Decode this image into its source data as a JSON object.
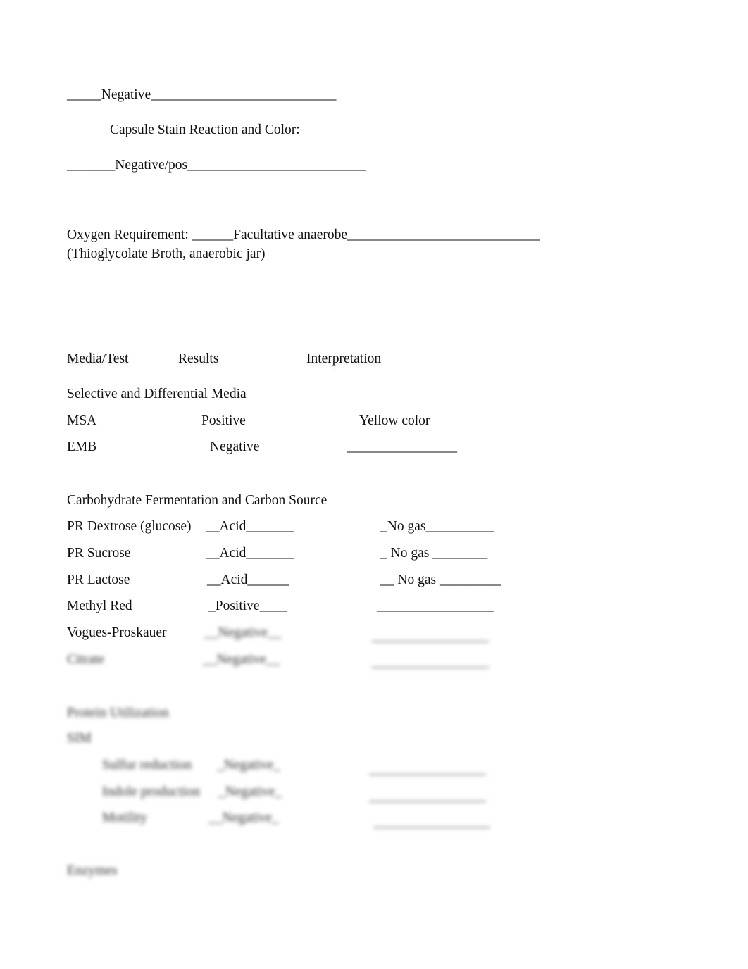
{
  "gram": {
    "line": "_____Negative___________________________"
  },
  "capsule": {
    "label": "Capsule Stain Reaction and Color:",
    "line": "_______Negative/pos__________________________"
  },
  "oxygen": {
    "label": "Oxygen Requirement: ______Facultative anaerobe____________________________",
    "note": "(Thioglycolate Broth, anaerobic jar)"
  },
  "table_headers": [
    "Media/Test",
    "Results",
    "Interpretation"
  ],
  "selective": {
    "heading": "Selective and Differential Media",
    "rows": [
      {
        "test": "MSA",
        "result": "Positive",
        "interp": "Yellow color"
      },
      {
        "test": "EMB",
        "result": "Negative",
        "interp": "________________"
      }
    ]
  },
  "carbo": {
    "heading": "Carbohydrate Fermentation and Carbon Source",
    "rows": [
      {
        "test": "PR Dextrose (glucose)",
        "result": "__Acid_______",
        "interp": "_No gas__________"
      },
      {
        "test": "PR Sucrose",
        "result": "__Acid_______",
        "interp": "_ No gas ________"
      },
      {
        "test": "PR Lactose",
        "result": "__Acid______",
        "interp": "__ No gas _________"
      },
      {
        "test": "Methyl Red",
        "result": "_Positive____",
        "interp": "_________________"
      },
      {
        "test": "Vogues-Proskauer",
        "result": "__Negative__",
        "interp": "_________________"
      },
      {
        "test": "Citrate",
        "result": "__Negative__",
        "interp": "_________________"
      }
    ]
  },
  "protein": {
    "heading": "Protein Utilization",
    "sub": "SIM",
    "rows": [
      {
        "test": "Sulfur reduction",
        "result": "_Negative_",
        "interp": "_________________"
      },
      {
        "test": "Indole production",
        "result": "_Negative_",
        "interp": "_________________"
      },
      {
        "test": "Motility",
        "result": "__Negative_",
        "interp": "_________________"
      }
    ]
  },
  "enzymes": {
    "heading": "Enzymes"
  }
}
